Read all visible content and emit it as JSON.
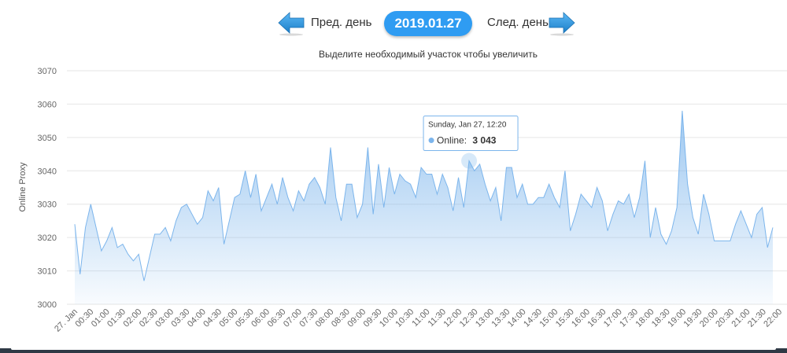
{
  "nav": {
    "prev_label": "Пред. день",
    "next_label": "След. день",
    "date": "2019.01.27"
  },
  "colors": {
    "accent": "#2f9cf2",
    "series_line": "#7cb5ec",
    "arrow": "#2f9cf2"
  },
  "chart_data": {
    "type": "area",
    "subtitle": "Выделите необходимый участок чтобы увеличить",
    "ylabel": "Online Proxy",
    "xlabel": "",
    "ylim": [
      3000,
      3070
    ],
    "yticks": [
      "3000",
      "3010",
      "3020",
      "3030",
      "3040",
      "3050",
      "3060",
      "3070"
    ],
    "grid": true,
    "legend": "none",
    "x_tick_labels": [
      "27. Jan",
      "00:30",
      "01:00",
      "01:30",
      "02:00",
      "02:30",
      "03:00",
      "03:30",
      "04:00",
      "04:30",
      "05:00",
      "05:30",
      "06:00",
      "06:30",
      "07:00",
      "07:30",
      "08:00",
      "08:30",
      "09:00",
      "09:30",
      "10:00",
      "10:30",
      "11:00",
      "11:30",
      "12:00",
      "12:30",
      "13:00",
      "13:30",
      "14:00",
      "14:30",
      "15:00",
      "15:30",
      "16:00",
      "16:30",
      "17:00",
      "17:30",
      "18:00",
      "18:30",
      "19:00",
      "19:30",
      "20:00",
      "20:30",
      "21:00",
      "21:30",
      "22:00"
    ],
    "series": [
      {
        "interval_minutes": 10,
        "values": [
          3024,
          3009,
          3023,
          3030,
          3023,
          3016,
          3019,
          3023,
          3017,
          3018,
          3015,
          3013,
          3015,
          3007,
          3014,
          3021,
          3021,
          3023,
          3019,
          3025,
          3029,
          3030,
          3027,
          3024,
          3026,
          3034,
          3031,
          3035,
          3018,
          3025,
          3032,
          3033,
          3040,
          3032,
          3039,
          3028,
          3032,
          3036,
          3030,
          3038,
          3032,
          3028,
          3034,
          3031,
          3036,
          3038,
          3035,
          3030,
          3047,
          3032,
          3025,
          3036,
          3036,
          3026,
          3030,
          3047,
          3027,
          3042,
          3029,
          3041,
          3033,
          3039,
          3037,
          3036,
          3032,
          3041,
          3039,
          3039,
          3033,
          3039,
          3035,
          3028,
          3038,
          3029,
          3043,
          3040,
          3042,
          3036,
          3031,
          3035,
          3025,
          3041,
          3041,
          3032,
          3036,
          3030,
          3030,
          3032,
          3032,
          3036,
          3032,
          3029,
          3040,
          3022,
          3027,
          3033,
          3031,
          3029,
          3035,
          3031,
          3022,
          3027,
          3031,
          3030,
          3033,
          3026,
          3032,
          3043,
          3020,
          3029,
          3021,
          3018,
          3022,
          3029,
          3058,
          3036,
          3026,
          3021,
          3033,
          3027,
          3019,
          3019,
          3019,
          3019,
          3024,
          3028,
          3024,
          3020,
          3027,
          3029,
          3017,
          3023
        ]
      }
    ],
    "tooltip": {
      "header": "Sunday, Jan 27, 12:20",
      "series_name": "Online:",
      "value": "3 043",
      "point_index": 74
    }
  }
}
